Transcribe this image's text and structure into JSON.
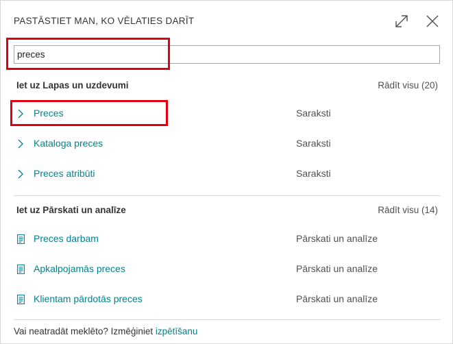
{
  "dialog": {
    "title": "PASTĀSTIET MAN, KO VĒLATIES DARĪT",
    "expand_icon": "expand-icon",
    "close_icon": "close-icon"
  },
  "search": {
    "value": "preces"
  },
  "sections": [
    {
      "title": "Iet uz Lapas un uzdevumi",
      "show_all": "Rādīt visu (20)",
      "items": [
        {
          "name": "Preces",
          "category": "Saraksti",
          "icon": "chevron-right-icon"
        },
        {
          "name": "Kataloga preces",
          "category": "Saraksti",
          "icon": "chevron-right-icon"
        },
        {
          "name": "Preces atribūti",
          "category": "Saraksti",
          "icon": "chevron-right-icon"
        }
      ]
    },
    {
      "title": "Iet uz Pārskati un analīze",
      "show_all": "Rādīt visu (14)",
      "items": [
        {
          "name": "Preces darbam",
          "category": "Pārskati un analīze",
          "icon": "report-icon"
        },
        {
          "name": "Apkalpojamās preces",
          "category": "Pārskati un analīze",
          "icon": "report-icon"
        },
        {
          "name": "Klientam pārdotās preces",
          "category": "Pārskati un analīze",
          "icon": "report-icon"
        }
      ]
    }
  ],
  "footer": {
    "text": "Vai neatradāt meklēto? Izmēģiniet ",
    "link": "izpētīšanu"
  },
  "highlight_color": "#e0000f",
  "link_color": "#00838f"
}
